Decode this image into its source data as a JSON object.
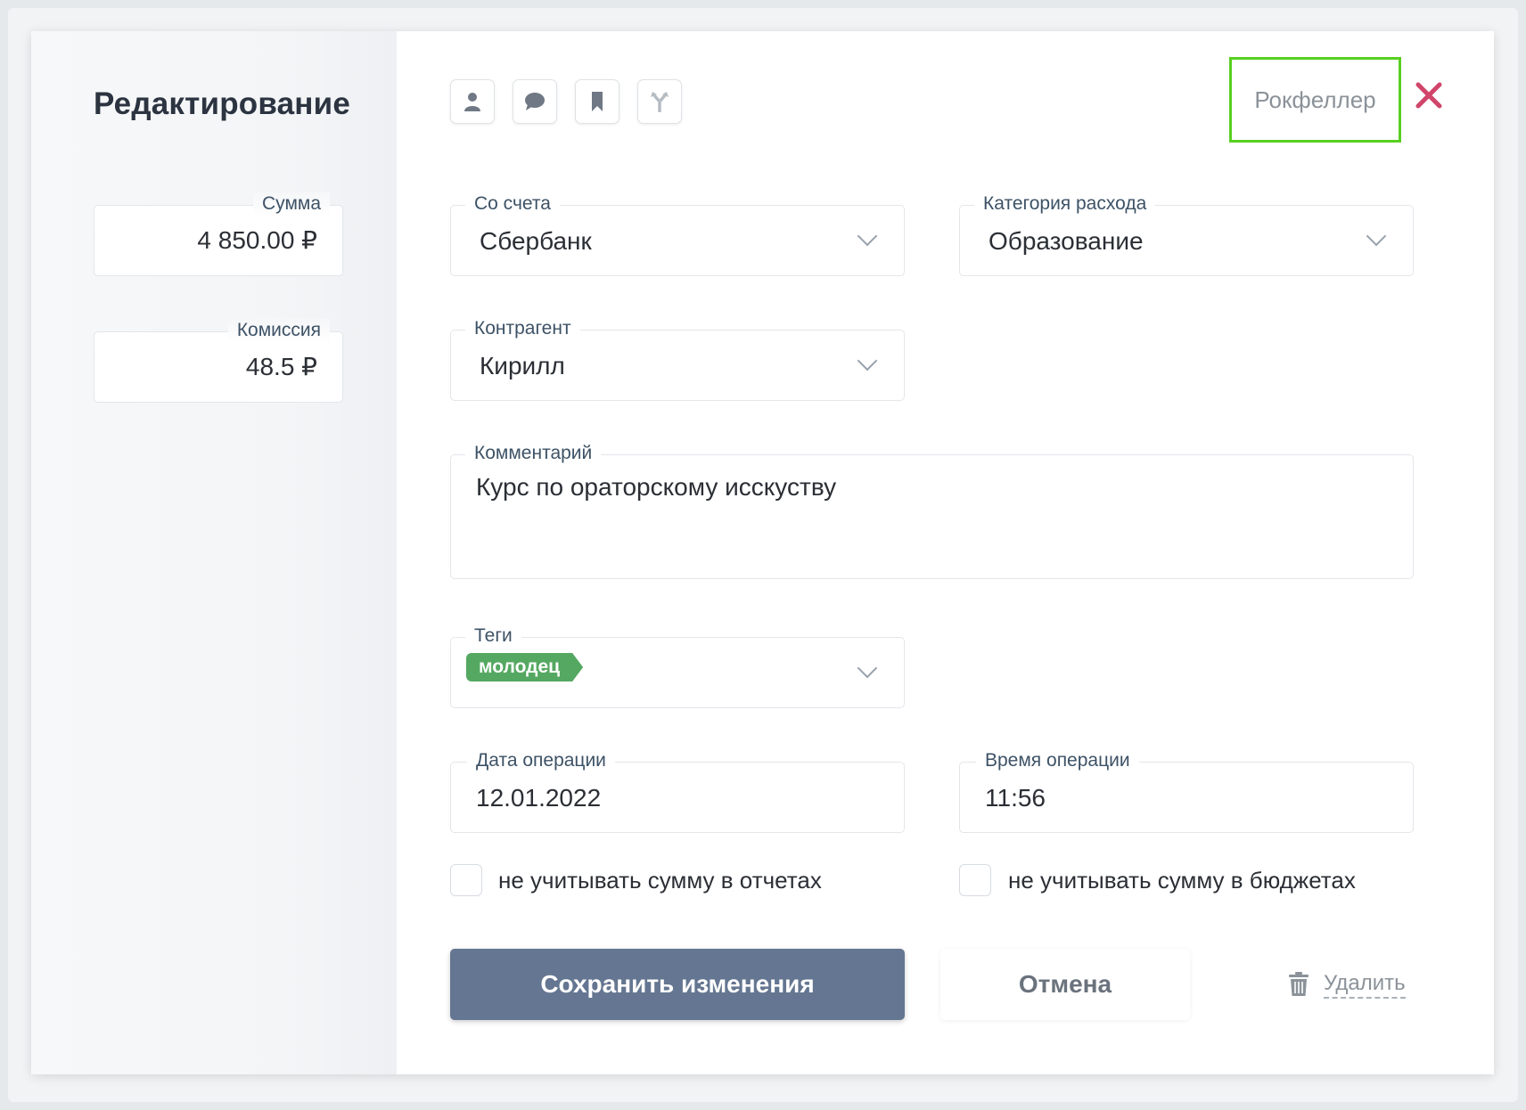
{
  "dialog": {
    "title": "Редактирование",
    "owner": "Рокфеллер"
  },
  "toolbar": {
    "icons": [
      "user-icon",
      "comment-icon",
      "bookmark-icon",
      "split-icon"
    ]
  },
  "amount": {
    "label": "Сумма",
    "value": "4 850.00 ₽"
  },
  "commission": {
    "label": "Комиссия",
    "value": "48.5 ₽"
  },
  "account": {
    "label": "Со счета",
    "value": "Сбербанк"
  },
  "category": {
    "label": "Категория расхода",
    "value": "Образование"
  },
  "counterparty": {
    "label": "Контрагент",
    "value": "Кирилл"
  },
  "comment": {
    "label": "Комментарий",
    "value": "Курс по ораторскому исскуству"
  },
  "tags": {
    "label": "Теги",
    "items": [
      "молодец"
    ]
  },
  "date": {
    "label": "Дата операции",
    "value": "12.01.2022"
  },
  "time": {
    "label": "Время операции",
    "value": "11:56"
  },
  "options": {
    "exclude_reports": "не учитывать сумму в отчетах",
    "exclude_budgets": "не учитывать сумму в бюджетах"
  },
  "actions": {
    "save": "Сохранить изменения",
    "cancel": "Отмена",
    "delete": "Удалить"
  },
  "colors": {
    "save_button": "#647691",
    "tag": "#55a861",
    "close": "#d0456a",
    "highlight": "#58d020"
  }
}
